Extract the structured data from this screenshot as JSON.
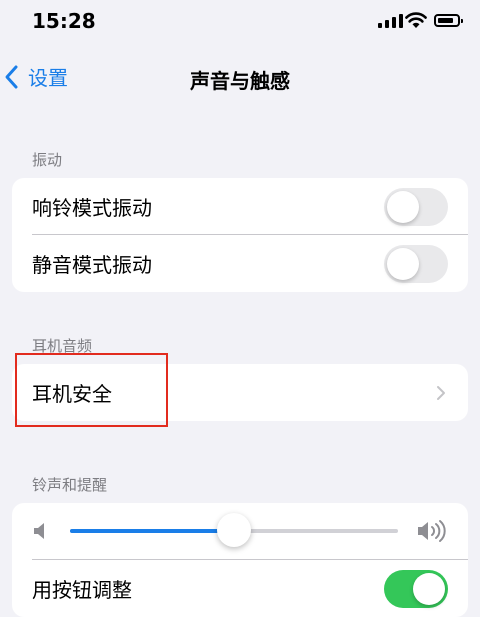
{
  "status": {
    "time": "15:28"
  },
  "nav": {
    "back_label": "设置",
    "title": "声音与触感"
  },
  "sections": {
    "vibration": {
      "header": "振动",
      "rows": [
        {
          "label": "响铃模式振动",
          "toggle_on": false
        },
        {
          "label": "静音模式振动",
          "toggle_on": false
        }
      ]
    },
    "headphone_audio": {
      "header": "耳机音频",
      "rows": [
        {
          "label": "耳机安全"
        }
      ]
    },
    "ringtones_alerts": {
      "header": "铃声和提醒",
      "volume_level": 0.5,
      "rows": [
        {
          "label": "用按钮调整",
          "toggle_on": true
        }
      ]
    }
  },
  "colors": {
    "accent": "#1a7ee8",
    "toggle_on": "#34c759",
    "highlight_border": "#e22b1e",
    "background": "#f2f2f7"
  }
}
